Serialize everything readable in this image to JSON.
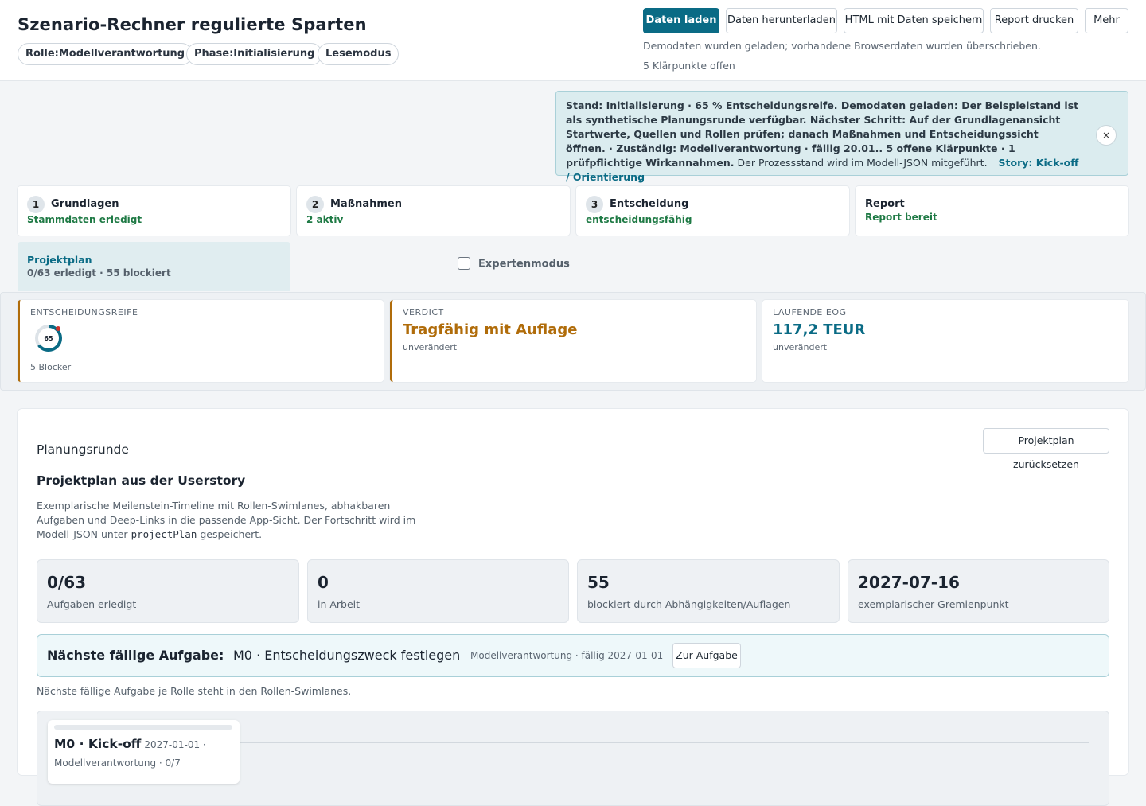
{
  "header": {
    "title": "Szenario-Rechner regulierte Sparten",
    "chips": [
      "Rolle:Modellverantwortung",
      "Phase:Initialisierung",
      "Lesemodus"
    ],
    "buttons": {
      "load": "Daten laden",
      "download": "Daten herunterladen",
      "save_html": "HTML mit Daten speichern",
      "print": "Report drucken",
      "more": "Mehr"
    },
    "status_message": "Demodaten wurden geladen; vorhandene Browserdaten wurden überschrieben.",
    "open_points": "5 Klärpunkte offen"
  },
  "banner": {
    "bold_text": "Stand: Initialisierung · 65 % Entscheidungsreife. Demodaten geladen: Der Beispielstand ist als synthetische Planungsrunde verfügbar. Nächster Schritt: Auf der Grundlagenansicht Startwerte, Quellen und Rollen prüfen; danach Maßnahmen und Entscheidungssicht öffnen. · Zuständig: Modellverantwortung · fällig 20.01.. 5 offene Klärpunkte · 1 prüfpflichtige Wirkannahmen.",
    "plain_text": "Der Prozessstand wird im Modell-JSON mitgeführt.",
    "story_link": "Story: Kick-off / Orientierung",
    "close": "×"
  },
  "steps": [
    {
      "num": "1",
      "title": "Grundlagen",
      "sub": "Stammdaten erledigt"
    },
    {
      "num": "2",
      "title": "Maßnahmen",
      "sub": "2 aktiv"
    },
    {
      "num": "3",
      "title": "Entscheidung",
      "sub": "entscheidungsfähig"
    },
    {
      "num": "",
      "title": "Report",
      "sub": "Report bereit"
    }
  ],
  "projectplan_tab": {
    "title": "Projektplan",
    "sub": "0/63 erledigt · 55 blockiert"
  },
  "expert_mode": {
    "label": "Expertenmodus",
    "checked": false
  },
  "kpis": {
    "readiness": {
      "label": "ENTSCHEIDUNGSREIFE",
      "value": "65",
      "percent": 65,
      "sub": "5 Blocker",
      "ring_color": "#0a6b85",
      "dot_color": "#d0342c"
    },
    "verdict": {
      "label": "VERDICT",
      "value": "Tragfähig mit Auflage",
      "sub": "unverändert",
      "color": "#b06c0a"
    },
    "eog": {
      "label": "LAUFENDE EOG",
      "value": "117,2 TEUR",
      "sub": "unverändert",
      "color": "#0a6b85"
    }
  },
  "panel": {
    "eyebrow": "Planungsrunde",
    "title": "Projektplan aus der Userstory",
    "desc_1": "Exemplarische Meilenstein-Timeline mit Rollen-Swimlanes, abhakbaren Aufgaben und Deep-Links in die passende App-Sicht. Der Fortschritt wird im Modell-JSON unter",
    "desc_code": "projectPlan",
    "desc_2": "gespeichert.",
    "reset_button": "Projektplan zurücksetzen",
    "stats": [
      {
        "value": "0/63",
        "label": "Aufgaben erledigt"
      },
      {
        "value": "0",
        "label": "in Arbeit"
      },
      {
        "value": "55",
        "label": "blockiert durch Abhängigkeiten/Auflagen"
      },
      {
        "value": "2027-07-16",
        "label": "exemplarischer Gremienpunkt"
      }
    ],
    "next_task": {
      "lead": "Nächste fällige Aufgabe:",
      "task": "M0 · Entscheidungszweck festlegen",
      "meta": "Modellverantwortung · fällig 2027-01-01",
      "button": "Zur Aufgabe"
    },
    "note": "Nächste fällige Aufgabe je Rolle steht in den Rollen-Swimlanes.",
    "milestone": {
      "title": "M0 · Kick-off",
      "date": "2027-01-01 ·",
      "role": "Modellverantwortung · 0/7"
    }
  }
}
